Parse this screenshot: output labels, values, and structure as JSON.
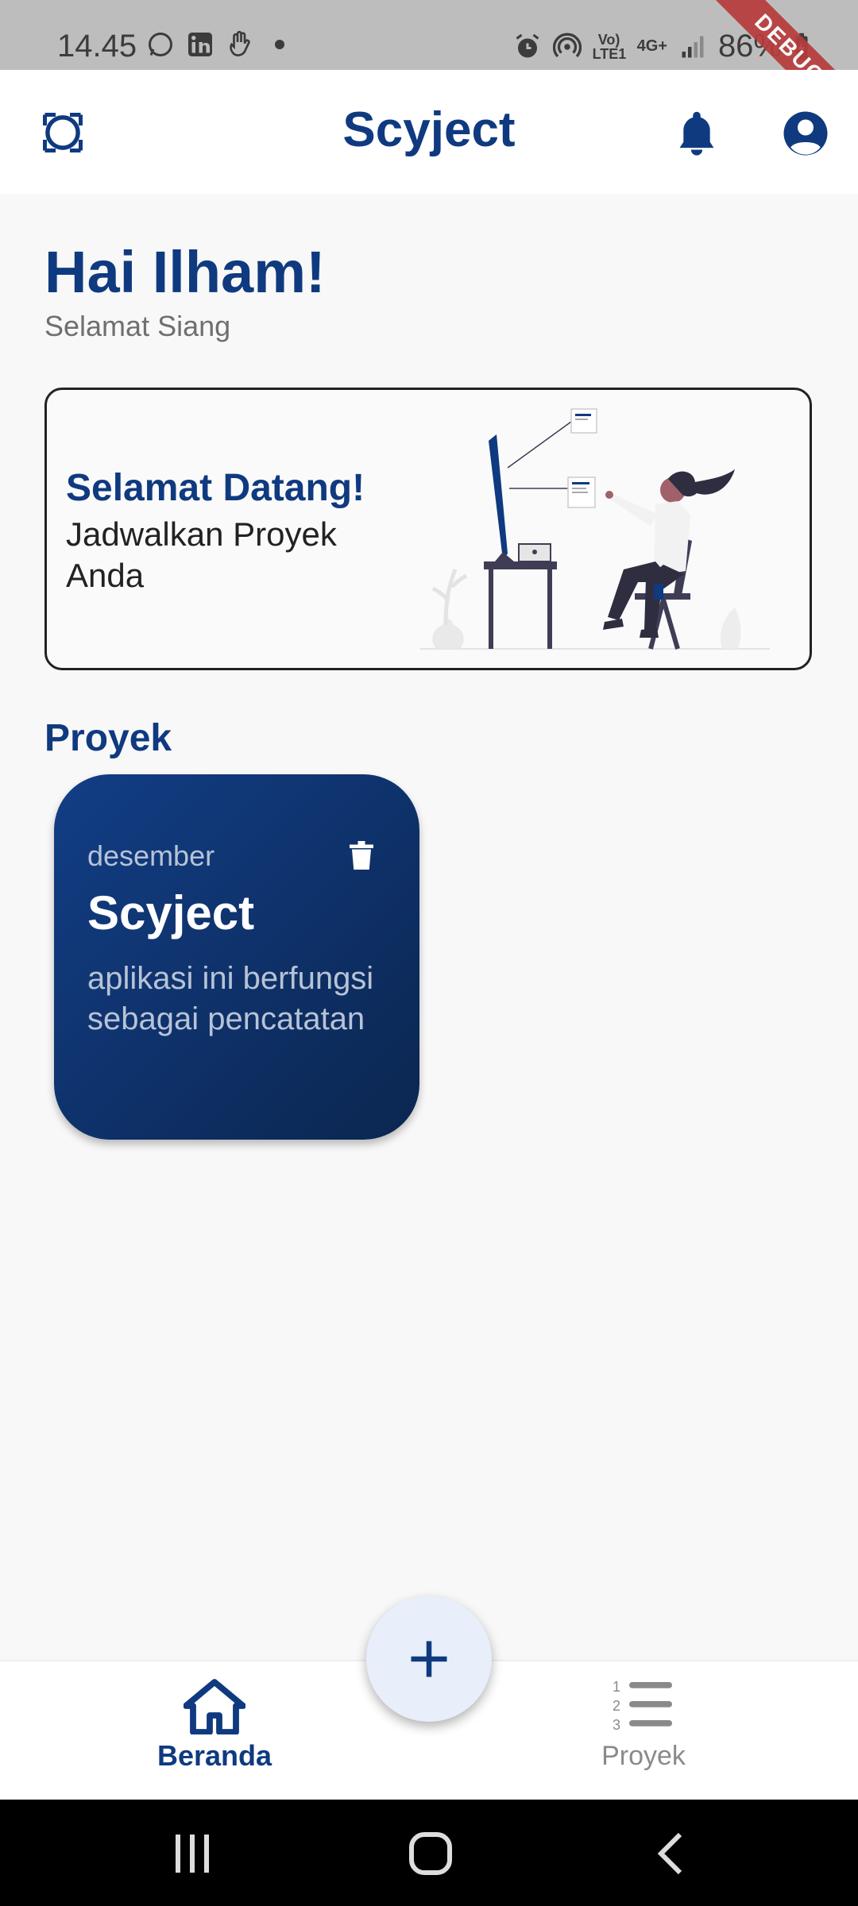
{
  "status_bar": {
    "time": "14.45",
    "battery": "86%",
    "network_label": "4G+",
    "volte_label": "Vo) LTE1",
    "debug_banner": "DEBUG"
  },
  "app_bar": {
    "title": "Scyject",
    "left_icon": "lens-icon",
    "notification_icon": "bell-icon",
    "profile_icon": "account-circle-icon"
  },
  "greeting": {
    "title": "Hai Ilham!",
    "subtitle": "Selamat Siang"
  },
  "welcome_card": {
    "title": "Selamat Datang!",
    "subtitle": "Jadwalkan Proyek Anda"
  },
  "projects_section": {
    "title": "Proyek",
    "items": [
      {
        "month": "desember",
        "title": "Scyject",
        "description": "aplikasi ini berfungsi sebagai pencatatan"
      }
    ]
  },
  "bottom_nav": {
    "home_label": "Beranda",
    "projects_label": "Proyek"
  },
  "colors": {
    "primary": "#0f3a80",
    "card_gradient_start": "#123e86",
    "card_gradient_end": "#0b2650",
    "fab_background": "#e8effa",
    "debug": "#b83b3b"
  }
}
